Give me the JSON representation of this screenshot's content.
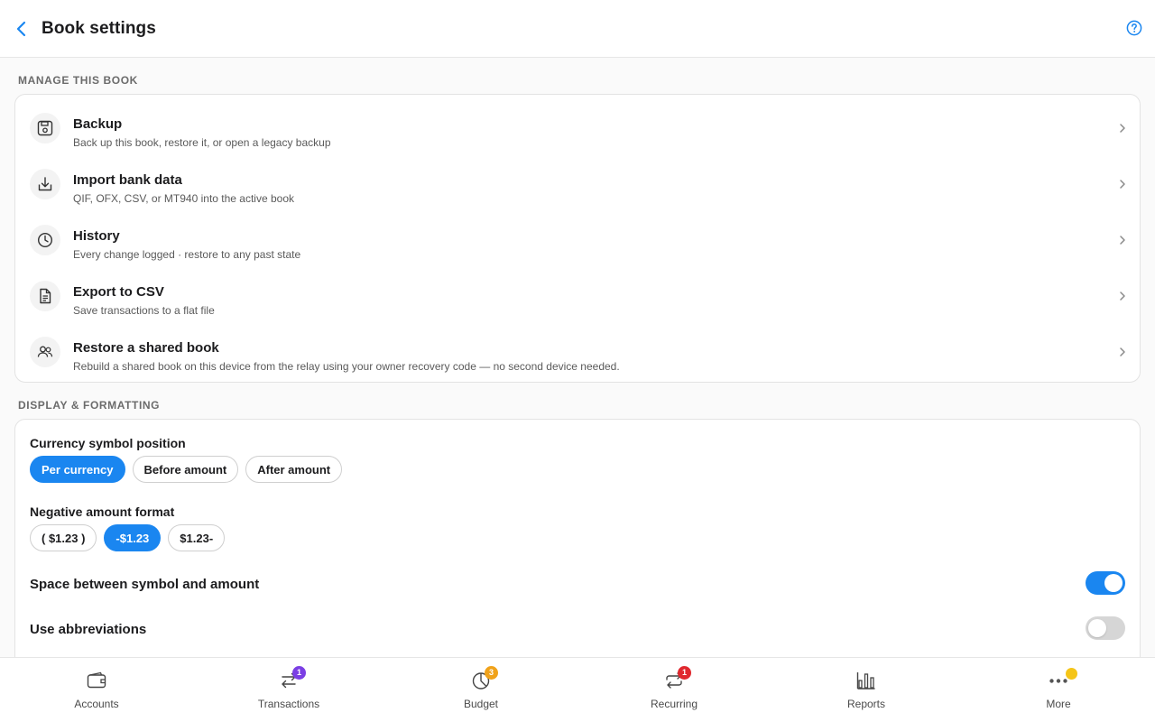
{
  "header": {
    "title": "Book settings",
    "back_icon": "chevron-left-icon",
    "help_icon": "help-circle-icon"
  },
  "colors": {
    "accent": "#1a86f0",
    "badge_purple": "#7b3fe4",
    "badge_orange": "#f0a21a",
    "badge_red": "#e0282e",
    "dot_yellow": "#f5c518"
  },
  "manage": {
    "section_title": "MANAGE THIS BOOK",
    "items": [
      {
        "icon": "save-icon",
        "title": "Backup",
        "subtitle": "Back up this book, restore it, or open a legacy backup"
      },
      {
        "icon": "download-icon",
        "title": "Import bank data",
        "subtitle": "QIF, OFX, CSV, or MT940 into the active book"
      },
      {
        "icon": "clock-icon",
        "title": "History",
        "subtitle": "Every change logged · restore to any past state"
      },
      {
        "icon": "file-icon",
        "title": "Export to CSV",
        "subtitle": "Save transactions to a flat file"
      },
      {
        "icon": "users-icon",
        "title": "Restore a shared book",
        "subtitle": "Rebuild a shared book on this device from the relay using your owner recovery code — no second device needed."
      }
    ]
  },
  "display": {
    "section_title": "DISPLAY & FORMATTING",
    "currency_position": {
      "label": "Currency symbol position",
      "options": [
        "Per currency",
        "Before amount",
        "After amount"
      ],
      "selected": "Per currency"
    },
    "negative_format": {
      "label": "Negative amount format",
      "options": [
        "( $1.23 )",
        "-$1.23",
        "$1.23-"
      ],
      "selected": "-$1.23"
    },
    "space_between": {
      "label": "Space between symbol and amount",
      "enabled": true
    },
    "abbreviations": {
      "label": "Use abbreviations",
      "enabled": false
    }
  },
  "tabs": [
    {
      "label": "Accounts",
      "icon": "wallet-icon"
    },
    {
      "label": "Transactions",
      "icon": "transfer-icon",
      "badge": "1"
    },
    {
      "label": "Budget",
      "icon": "pie-chart-icon",
      "badge": "3"
    },
    {
      "label": "Recurring",
      "icon": "repeat-icon",
      "badge": "1"
    },
    {
      "label": "Reports",
      "icon": "bar-chart-icon"
    },
    {
      "label": "More",
      "icon": "more-horizontal-icon",
      "dot": true
    }
  ]
}
